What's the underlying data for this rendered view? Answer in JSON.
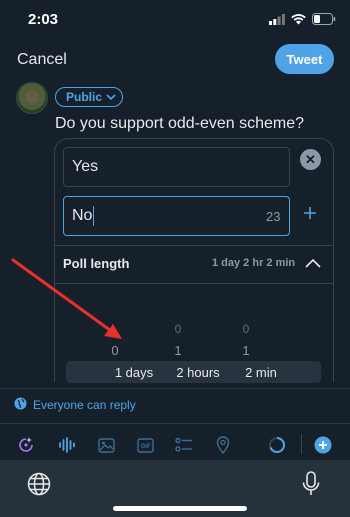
{
  "status_bar": {
    "time": "2:03"
  },
  "top_bar": {
    "cancel_label": "Cancel",
    "tweet_label": "Tweet"
  },
  "composer": {
    "audience_label": "Public",
    "question": "Do you support odd-even scheme?"
  },
  "poll": {
    "choices": [
      {
        "value": "Yes"
      },
      {
        "value": "No",
        "char_count": "23"
      }
    ],
    "length_label": "Poll length",
    "length_value": "1 day 2 hr 2 min",
    "picker": {
      "row_faint": [
        "",
        "0",
        "0"
      ],
      "row_above": [
        "0",
        "1",
        "1"
      ],
      "row_selected": [
        "1 days",
        "2 hours",
        "2 min"
      ]
    }
  },
  "reply_setting": {
    "label": "Everyone can reply"
  },
  "toolbar": {
    "icons": [
      "sparkle-icon",
      "audio-icon",
      "image-icon",
      "gif-icon",
      "poll-icon",
      "location-icon"
    ],
    "accent": "#4fa4e8"
  },
  "keyboard": {
    "icons": [
      "globe-icon",
      "microphone-icon"
    ]
  },
  "annotation": {
    "arrow_color": "#e8302a"
  }
}
